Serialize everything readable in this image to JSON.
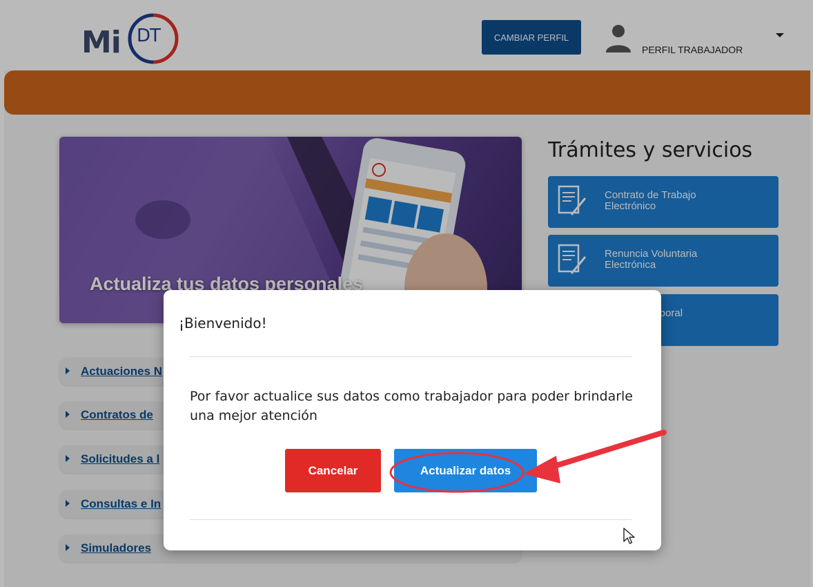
{
  "header": {
    "logo_text": "Mi",
    "logo_badge": "DT",
    "change_profile_label": "CAMBIAR PERFIL",
    "profile_label": "PERFIL TRABAJADOR",
    "user_icon": "user-icon",
    "dropdown_icon": "caret-down-icon"
  },
  "banner": {
    "text": "Actualiza tus datos personales"
  },
  "services": {
    "title": "Trámites y servicios",
    "items": [
      {
        "label": "Contrato de Trabajo\nElectrónico",
        "icon": "document-pen-icon"
      },
      {
        "label": "Renuncia Voluntaria\nElectrónica",
        "icon": "document-pen-icon"
      },
      {
        "label": "Laboral\nco",
        "icon": "document-pen-icon"
      }
    ]
  },
  "accordion": {
    "items": [
      {
        "label": "Actuaciones N"
      },
      {
        "label": "Contratos de"
      },
      {
        "label": "Solicitudes a l"
      },
      {
        "label": "Consultas e In"
      },
      {
        "label": "Simuladores"
      }
    ]
  },
  "modal": {
    "title": "¡Bienvenido!",
    "message": "Por favor actualice sus datos como trabajador para poder brindarle una mejor atención",
    "cancel_label": "Cancelar",
    "confirm_label": "Actualizar datos"
  },
  "colors": {
    "brand_blue": "#0f4f8f",
    "service_blue": "#1e7fd2",
    "orange_band": "#d0661b",
    "cancel_red": "#e12a25",
    "confirm_blue": "#1e86de",
    "annotation_red": "#e8333d"
  }
}
